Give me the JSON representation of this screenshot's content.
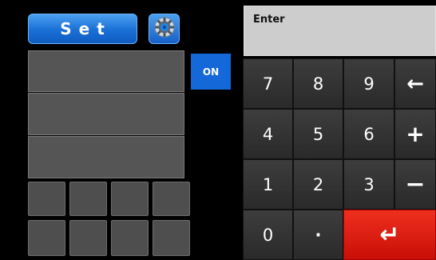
{
  "left_panel": {
    "set_label": "Set",
    "on_label": "ON",
    "settings_icon": "gear-icon"
  },
  "keypad": {
    "entry_prompt": "Enter",
    "keys": {
      "k7": "7",
      "k8": "8",
      "k9": "9",
      "backspace": "←",
      "k4": "4",
      "k5": "5",
      "k6": "6",
      "plus": "+",
      "k1": "1",
      "k2": "2",
      "k3": "3",
      "minus": "−",
      "k0": "0",
      "dot": "·",
      "enter": "↵"
    },
    "colors": {
      "enter": "#e0190f",
      "accent": "#1468d8"
    }
  }
}
